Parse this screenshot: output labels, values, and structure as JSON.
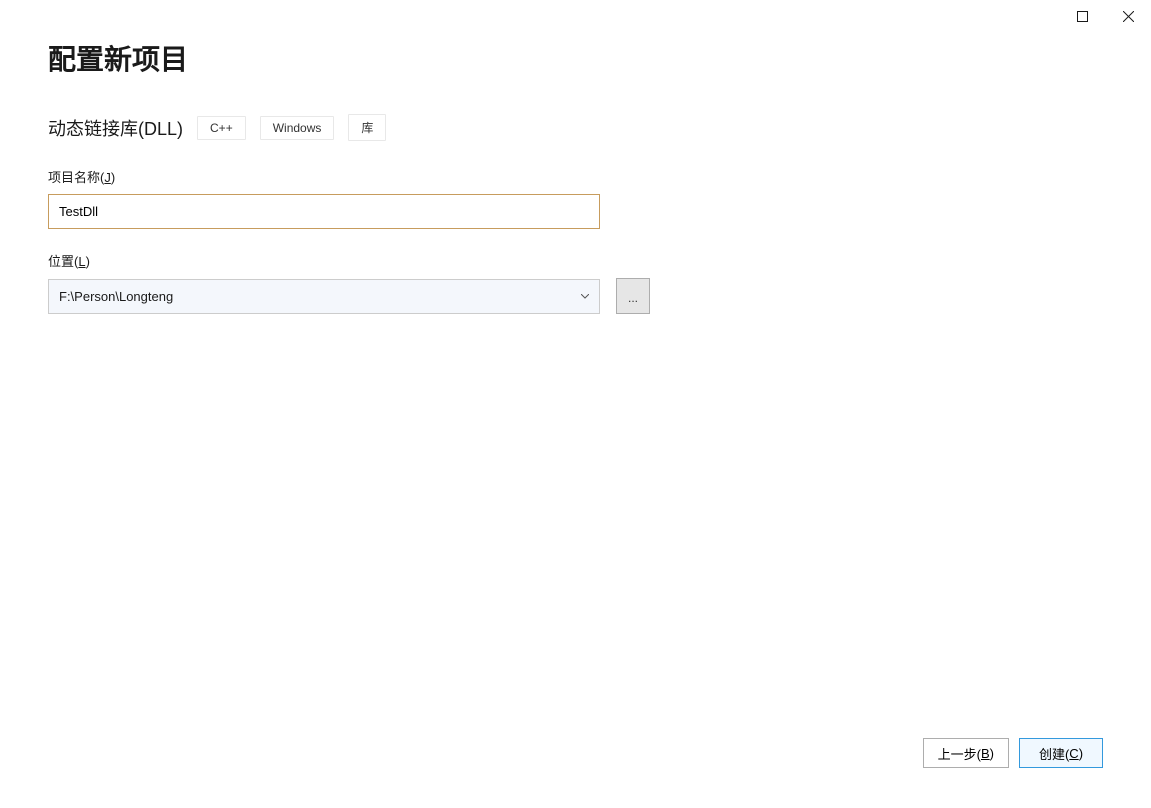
{
  "window": {
    "maximize_icon": "maximize",
    "close_icon": "close"
  },
  "page": {
    "title": "配置新项目"
  },
  "project_type": {
    "label": "动态链接库(DLL)",
    "tags": [
      "C++",
      "Windows",
      "库"
    ]
  },
  "fields": {
    "project_name": {
      "label_prefix": "项目名称(",
      "label_accelerator": "J",
      "label_suffix": ")",
      "value": "TestDll"
    },
    "location": {
      "label_prefix": "位置(",
      "label_accelerator": "L",
      "label_suffix": ")",
      "value": "F:\\Person\\Longteng",
      "browse_label": "..."
    }
  },
  "footer": {
    "back": {
      "prefix": "上一步(",
      "accelerator": "B",
      "suffix": ")"
    },
    "create": {
      "prefix": "创建(",
      "accelerator": "C",
      "suffix": ")"
    }
  }
}
